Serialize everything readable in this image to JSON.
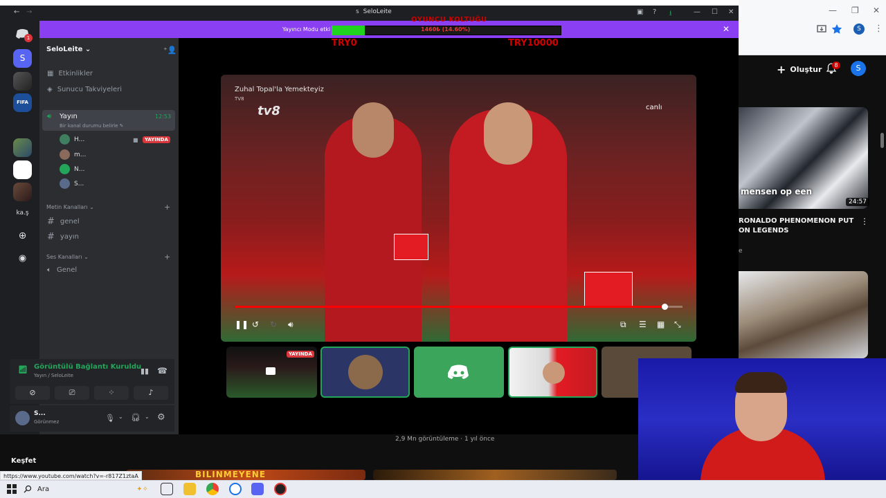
{
  "window": {
    "title": "SeloLeite",
    "icon_letter": "S"
  },
  "banner": {
    "text": "Yayıncı Modu etki",
    "close": "✕"
  },
  "overlay": {
    "title": "OYUNCU KOLTUĞU",
    "current": "1460₺ (14.60%)",
    "min_label": "TRY0",
    "max_label": "TRY10000",
    "progress_fraction": 0.146,
    "fill_color": "#1fd31f"
  },
  "rail": {
    "badge_count": "1",
    "text_server": "ka.ş",
    "user_letter": "S"
  },
  "server": {
    "name": "SeloLeite",
    "menu": [
      "Etkinlikler",
      "Sunucu Takviyeleri"
    ],
    "stream_channel": {
      "name": "Yayın",
      "time": "12:53",
      "status_placeholder": "Bir kanal durumu belirle"
    },
    "members": [
      {
        "name": "H...",
        "color": "#3f7f5f"
      },
      {
        "name": "m...",
        "color": "#8a6a5a"
      },
      {
        "name": "N...",
        "color": "#23a55a"
      },
      {
        "name": "S...",
        "color": "#5a6a8a"
      }
    ],
    "live_badge": "YAYINDA",
    "text_category": "Metin Kanalları",
    "text_channels": [
      "genel",
      "yayın"
    ],
    "voice_category": "Ses Kanalları",
    "voice_channels": [
      "Genel"
    ]
  },
  "voice": {
    "status": "Görüntülü Bağlantı Kuruldu",
    "location": "Yayın / SeloLeite"
  },
  "user": {
    "name": "S...",
    "status": "Görünmez"
  },
  "video": {
    "title": "Zuhal Topal'la Yemekteyiz",
    "channel": "TV8",
    "logo": "tv8",
    "live": "canlı",
    "progress_fraction": 0.96
  },
  "tiles": {
    "live_badge": "YAYINDA"
  },
  "youtube": {
    "create": "Oluştur",
    "bell_badge": "8",
    "avatar": "S",
    "thumb_caption": "mensen op een",
    "duration": "24:57",
    "video_title": "RONALDO PHENOMENON PUT ON LEGENDS",
    "meta": "e",
    "views": "2,9 Mn görüntüleme · 1 yıl önce",
    "explore": "Keşfet",
    "status_url": "https://www.youtube.com/watch?v=-r817Z1ztaA",
    "strip_text": "BILINMEYENE"
  },
  "taskbar": {
    "search": "Ara"
  },
  "colors": {
    "discord_dark": "#1e1f22",
    "sidebar": "#2b2d31",
    "banner": "#8a3ff2",
    "green": "#23a55a",
    "red": "#da373c",
    "blurple": "#5865f2"
  }
}
